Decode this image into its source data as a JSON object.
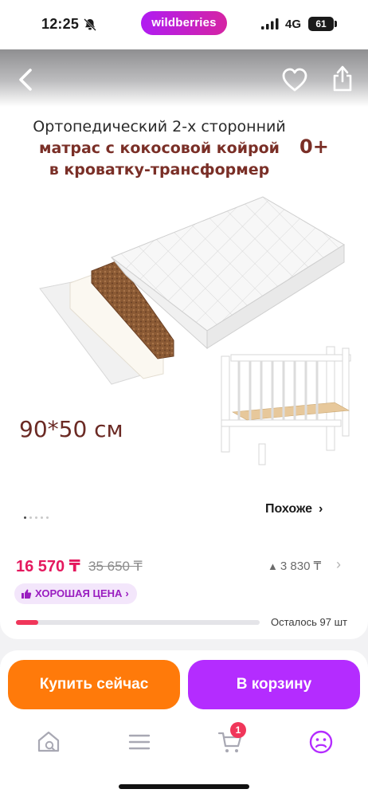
{
  "status_bar": {
    "time": "12:25",
    "brand": "wildberries",
    "network": "4G",
    "battery": "61"
  },
  "gallery": {
    "promo_title_line1": "Ортопедический 2-х сторонний",
    "promo_title_line2": "матрас с кокосовой койрой",
    "promo_title_line3": "в кроватку-трансформер",
    "age_badge": "0+",
    "size_label": "90*50 см",
    "similar_label": "Похоже",
    "similar_chevron": "›",
    "dots_active_index": 0
  },
  "price": {
    "current": "16 570 ₸",
    "old": "35 650 ₸",
    "delta": "3 830 ₸",
    "delta_arrow": "▲",
    "chevron": "›",
    "good_price_label": "ХОРОШАЯ ЦЕНА",
    "good_price_chevron": "›",
    "stock_text": "Осталось 97 шт",
    "stock_fraction": 0.09
  },
  "actions": {
    "buy_now": "Купить сейчас",
    "add_to_cart": "В корзину"
  },
  "tabbar": {
    "cart_count": "1",
    "accent_color": "#b42cff"
  },
  "colors": {
    "price": "#e4195e",
    "buy_button": "#ff7a0a",
    "cart_button": "#b42cff",
    "brand_gradient_start": "#b01cf2",
    "brand_gradient_end": "#d524a3"
  }
}
